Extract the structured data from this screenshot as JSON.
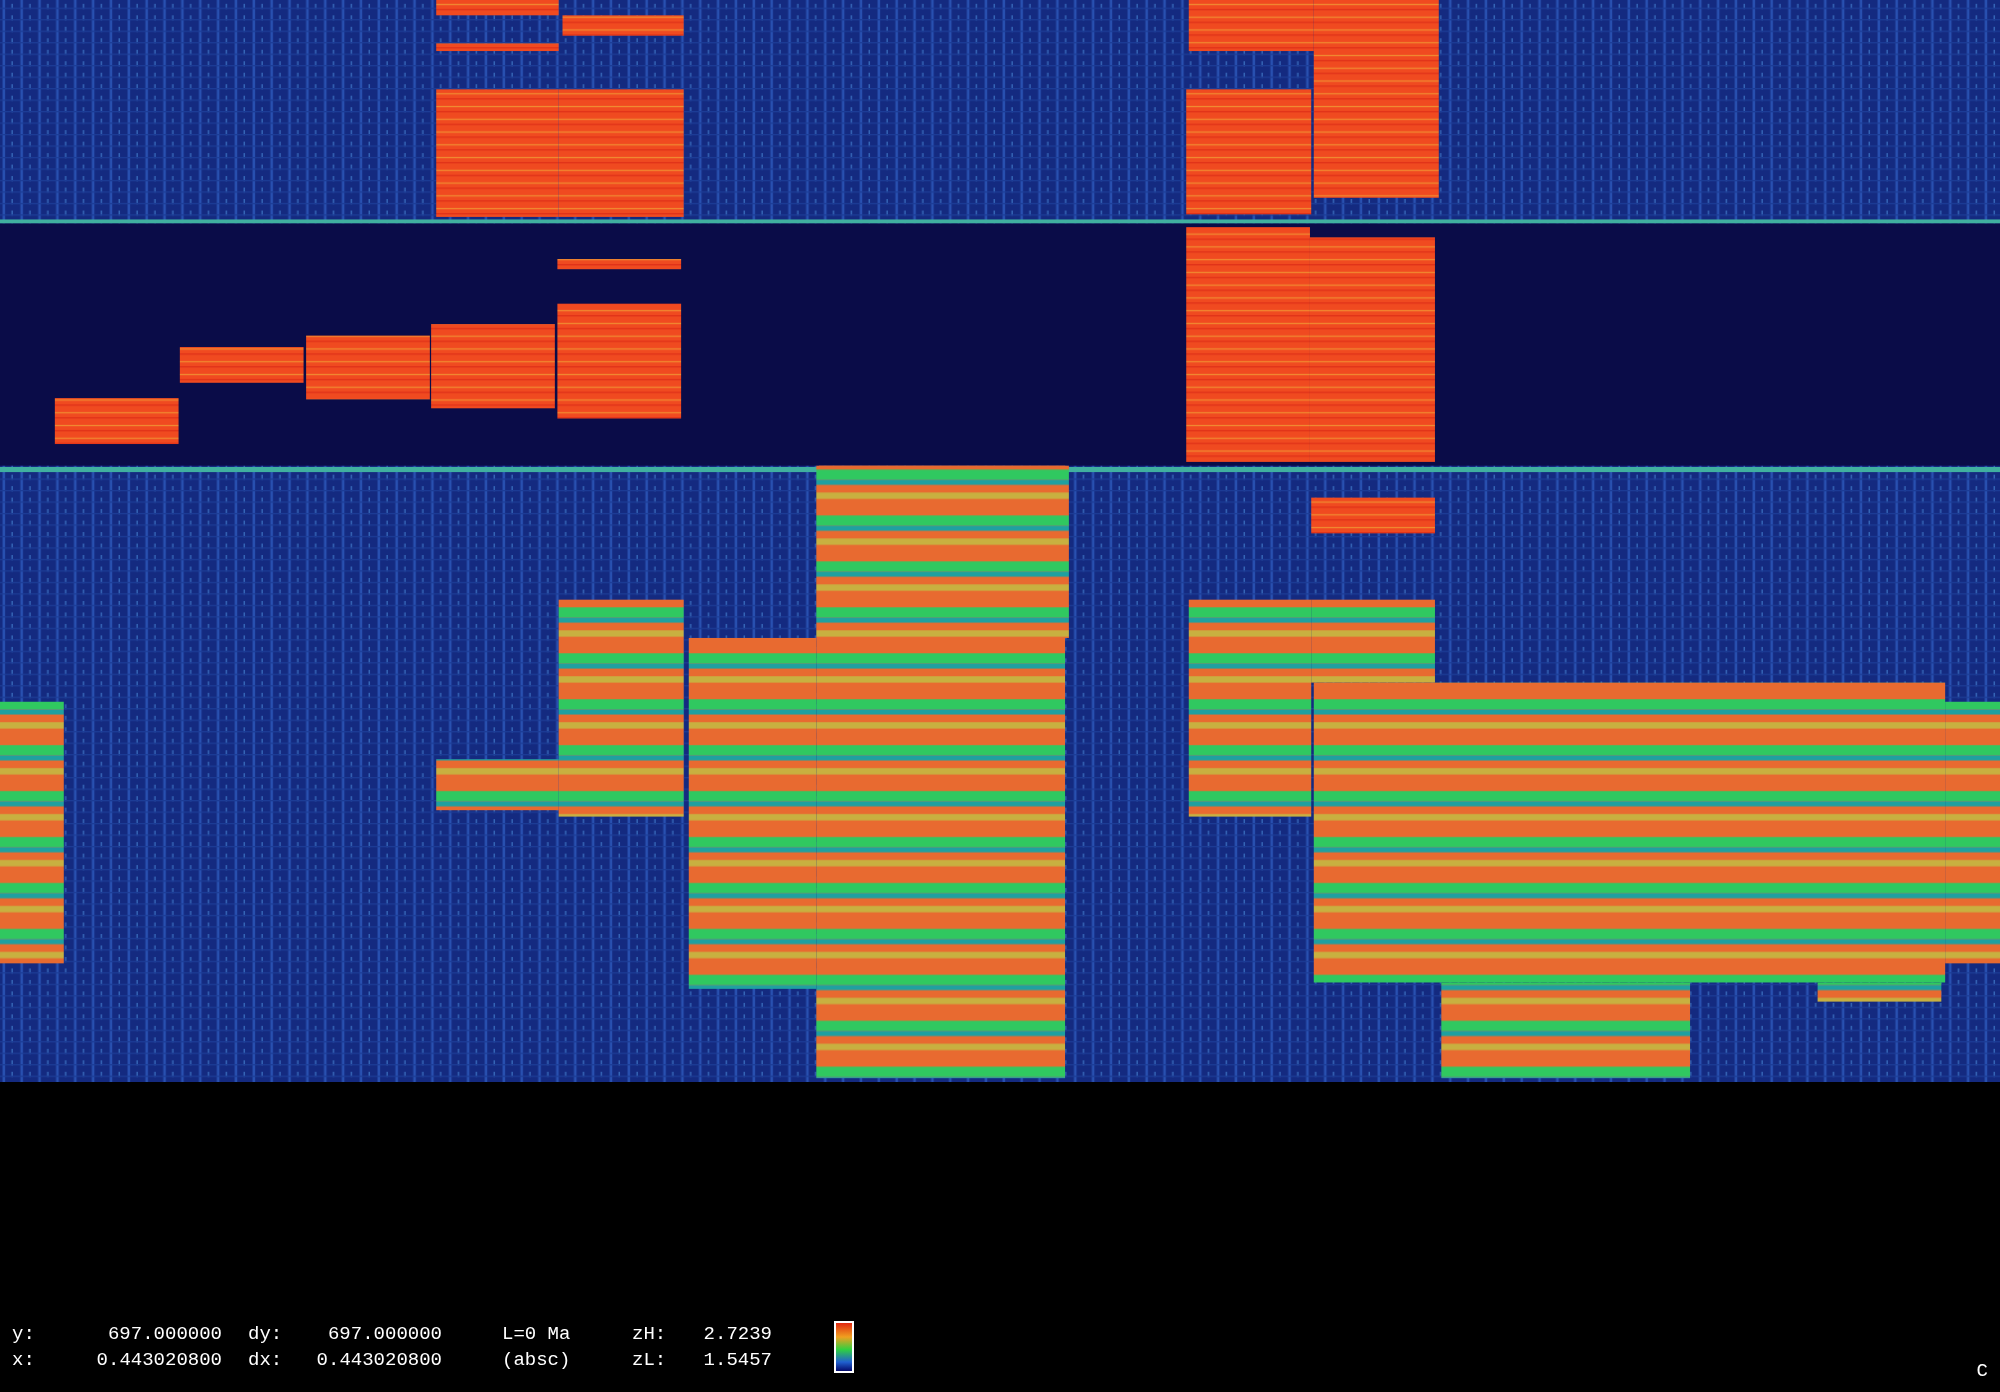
{
  "status_bar": {
    "rows": [
      {
        "axis": "y:",
        "axis_value": "697.000000",
        "delta": "dy:",
        "delta_value": "697.000000",
        "mode": "L=0 Ma",
        "z": "zH:",
        "z_value": "2.7239"
      },
      {
        "axis": "x:",
        "axis_value": "0.443020800",
        "delta": "dx:",
        "delta_value": "0.443020800",
        "mode": "(absc)",
        "z": "zL:",
        "z_value": "1.5457"
      }
    ]
  },
  "corner_label": "C"
}
